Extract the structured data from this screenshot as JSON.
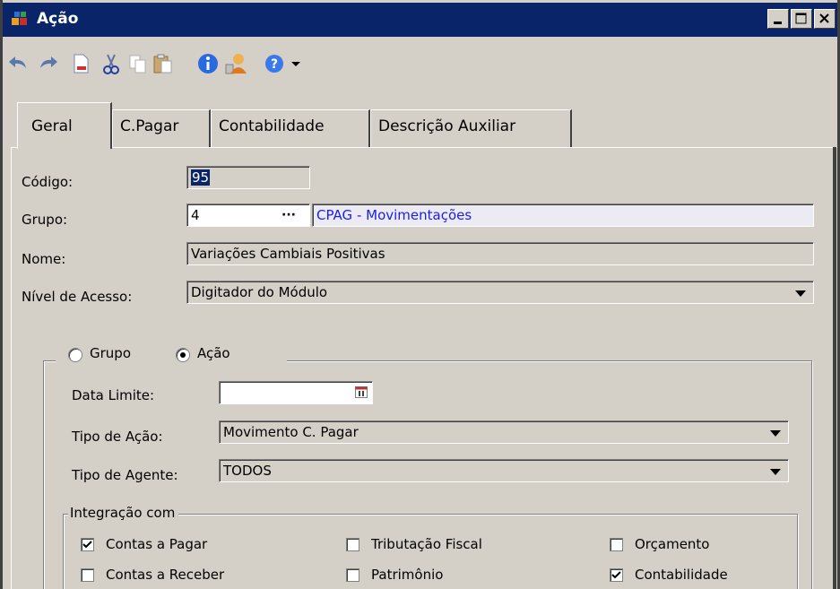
{
  "window": {
    "title": "Ação"
  },
  "tabs": [
    {
      "label": "Geral"
    },
    {
      "label": "C.Pagar"
    },
    {
      "label": "Contabilidade"
    },
    {
      "label": "Descrição Auxiliar"
    }
  ],
  "toolbar": {
    "icons": [
      "undo-icon",
      "redo-icon",
      "new-document-icon",
      "cut-icon",
      "copy-icon",
      "paste-icon",
      "info-icon",
      "user-icon",
      "help-icon",
      "dropdown-arrow-icon"
    ]
  },
  "form": {
    "codigo": {
      "label": "Código:",
      "value": "95"
    },
    "grupo": {
      "label": "Grupo:",
      "value": "4",
      "ellipsis": "···",
      "description": "CPAG - Movimentações"
    },
    "nome": {
      "label": "Nome:",
      "value": "Variações Cambiais Positivas"
    },
    "nivel": {
      "label": "Nível de Acesso:",
      "value": "Digitador do Módulo"
    }
  },
  "tipo": {
    "grupo_label": "Grupo",
    "acao_label": "Ação",
    "selected": "Ação"
  },
  "detail": {
    "data_limite": {
      "label": "Data Limite:",
      "value": ""
    },
    "tipo_acao": {
      "label": "Tipo de Ação:",
      "value": "Movimento C. Pagar"
    },
    "tipo_agente": {
      "label": "Tipo de Agente:",
      "value": "TODOS"
    }
  },
  "integracao": {
    "title": "Integração com",
    "items": [
      {
        "label": "Contas a Pagar",
        "checked": true
      },
      {
        "label": "Tributação Fiscal",
        "checked": false
      },
      {
        "label": "Orçamento",
        "checked": false
      },
      {
        "label": "Contas a Receber",
        "checked": false
      },
      {
        "label": "Patrimônio",
        "checked": false
      },
      {
        "label": "Contabilidade",
        "checked": true
      }
    ]
  },
  "colors": {
    "titlebar": "#0a246a",
    "face": "#d4d0c8",
    "link": "#1c1cf0"
  }
}
